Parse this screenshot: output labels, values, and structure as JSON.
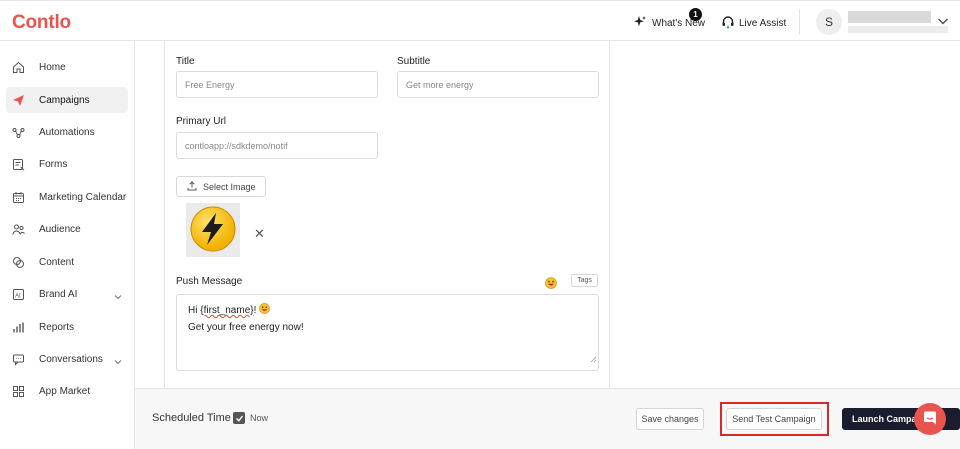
{
  "header": {
    "logo": "Contlo",
    "whats_new": "What's New",
    "whats_new_badge": "1",
    "live_assist": "Live Assist",
    "avatar_initial": "S"
  },
  "sidebar": {
    "items": [
      {
        "label": "Home",
        "icon": "home-icon"
      },
      {
        "label": "Campaigns",
        "icon": "paper-plane-icon",
        "active": true
      },
      {
        "label": "Automations",
        "icon": "automations-icon"
      },
      {
        "label": "Forms",
        "icon": "forms-icon"
      },
      {
        "label": "Marketing Calendar",
        "icon": "calendar-icon"
      },
      {
        "label": "Audience",
        "icon": "audience-icon"
      },
      {
        "label": "Content",
        "icon": "content-icon"
      },
      {
        "label": "Brand AI",
        "icon": "brand-ai-icon",
        "expandable": true
      },
      {
        "label": "Reports",
        "icon": "reports-icon"
      },
      {
        "label": "Conversations",
        "icon": "conversations-icon",
        "expandable": true
      },
      {
        "label": "App Market",
        "icon": "app-market-icon"
      }
    ]
  },
  "form": {
    "title_label": "Title",
    "title_value": "Free Energy",
    "subtitle_label": "Subtitle",
    "subtitle_value": "Get more energy",
    "primary_url_label": "Primary Url",
    "primary_url_value": "contloapp://sdkdemo/notif",
    "select_image_label": "Select Image",
    "image_icon": "lightning-bolt-icon",
    "push_message_label": "Push Message",
    "tags_label": "Tags",
    "message_line1_prefix": "Hi ",
    "message_name_token": "{first_name}",
    "message_line1_suffix": "! ",
    "message_line2": "Get your free energy now!"
  },
  "footer": {
    "scheduled_time_label": "Scheduled Time",
    "now_label": "Now",
    "now_checked": true,
    "save_changes": "Save changes",
    "send_test_campaign": "Send Test Campaign",
    "launch_campaign": "Launch Campaign"
  },
  "colors": {
    "brand": "#e8554e",
    "launch_button": "#1b1c2e",
    "highlight": "#d52a2a"
  }
}
